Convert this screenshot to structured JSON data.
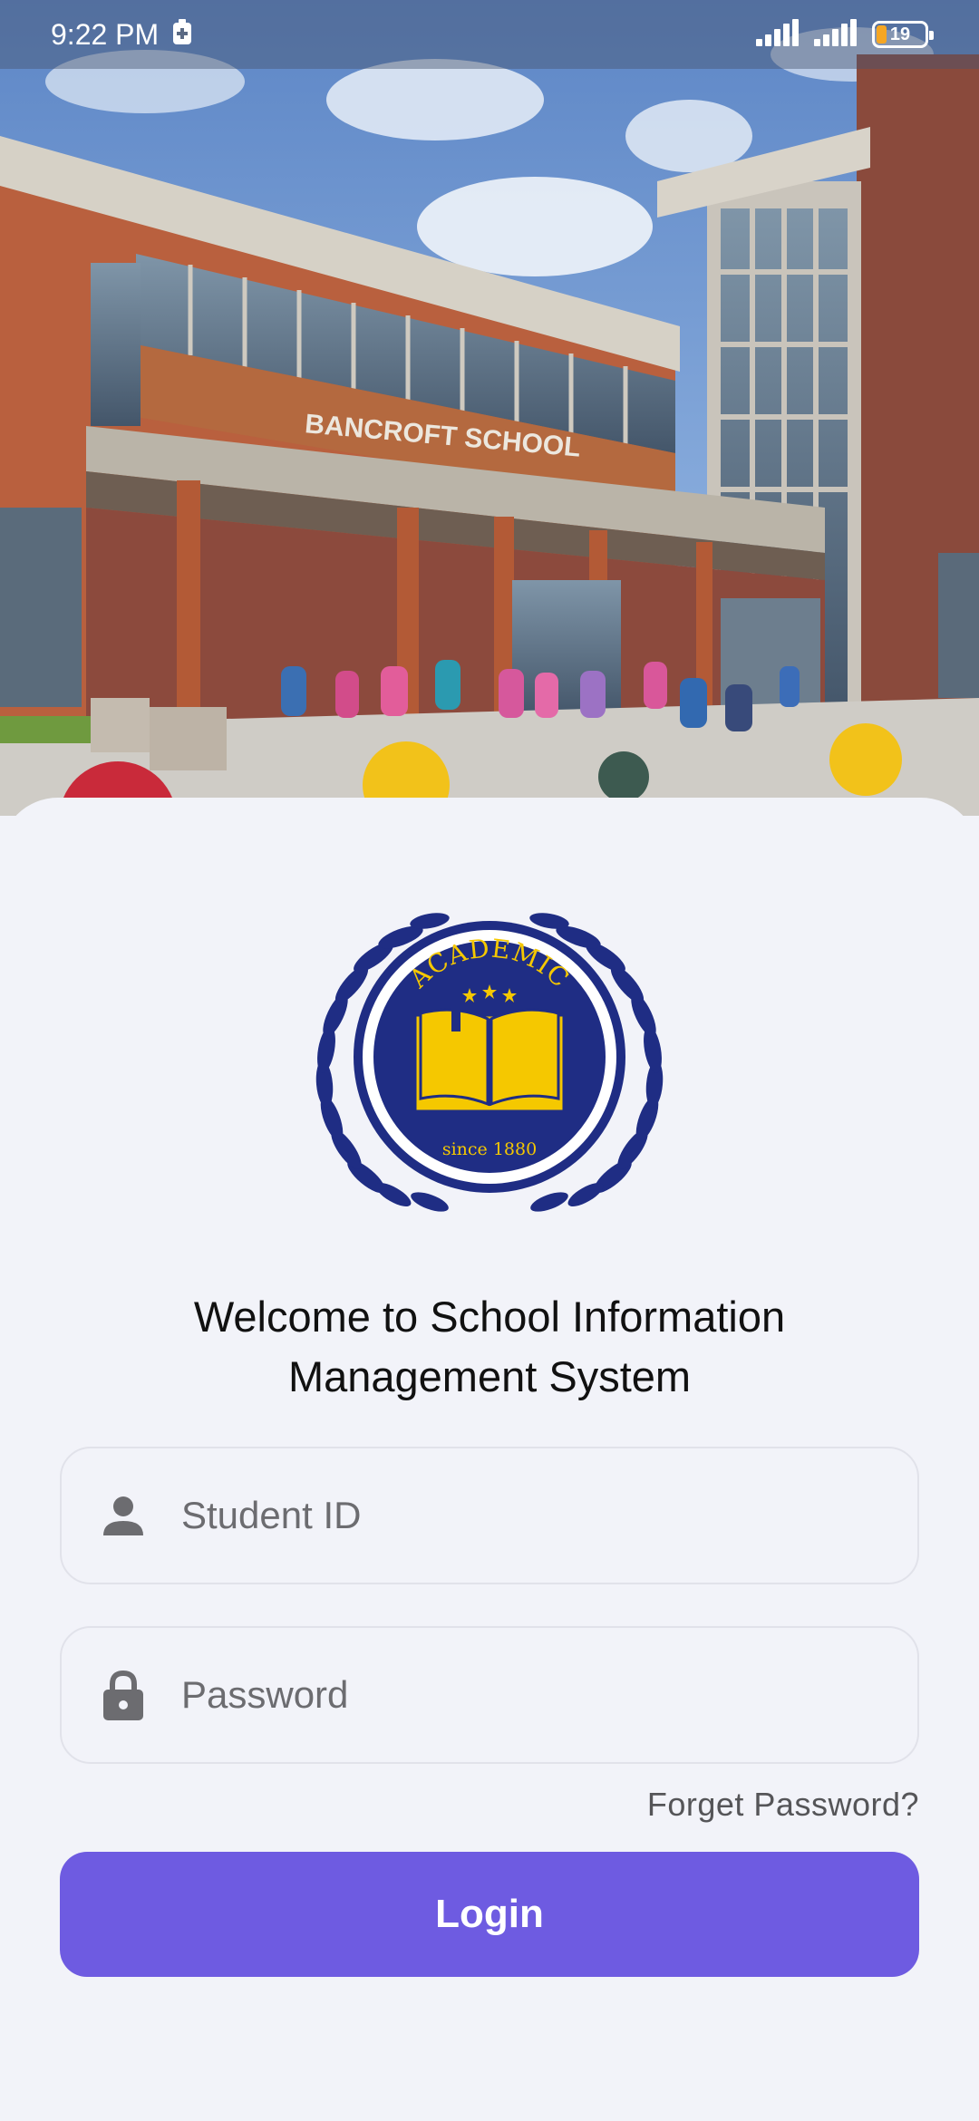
{
  "status_bar": {
    "time": "9:22 PM",
    "battery_level": "19",
    "icons": [
      "battery-saver-icon",
      "signal-icon",
      "signal-icon",
      "battery-icon"
    ]
  },
  "hero": {
    "building_sign": "BANCROFT SCHOOL"
  },
  "logo": {
    "arc_text": "ACADEMIC",
    "since_text": "since 1880",
    "colors": {
      "navy": "#1f2d84",
      "gold": "#f5c800"
    }
  },
  "welcome": {
    "line1": "Welcome to School Information",
    "line2": "Management System"
  },
  "form": {
    "student_id_placeholder": "Student ID",
    "password_placeholder": "Password",
    "forget_password": "Forget Password?",
    "login_label": "Login"
  },
  "colors": {
    "accent": "#6e5be1",
    "background": "#f2f3f9"
  }
}
